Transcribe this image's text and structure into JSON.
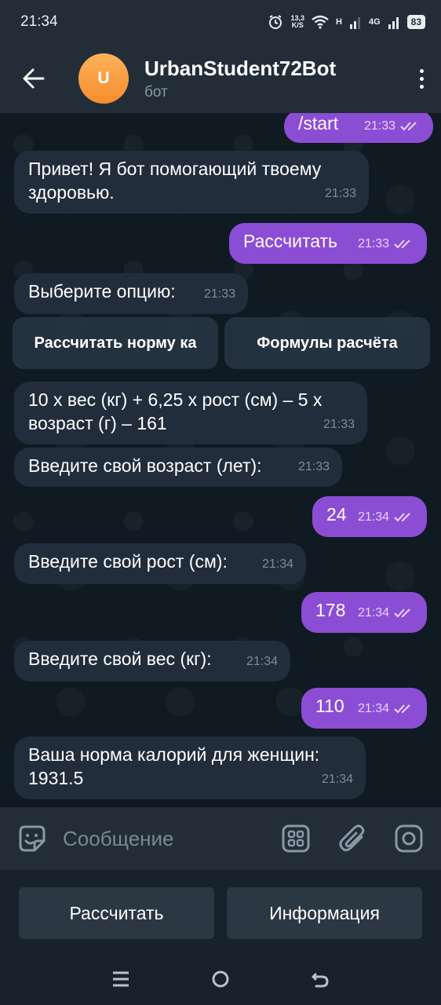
{
  "status_bar": {
    "time": "21:34",
    "net_speed_top": "13,3",
    "net_speed_bottom": "K/S",
    "network_type_1": "H",
    "network_type_2": "4G",
    "battery": "83"
  },
  "header": {
    "avatar_letter": "U",
    "title": "UrbanStudent72Bot",
    "subtitle": "бот"
  },
  "messages": [
    {
      "text": "/start",
      "time": "21:33"
    },
    {
      "text": "Привет! Я бот помогающий твоему здоровью.",
      "time": "21:33"
    },
    {
      "text": "Рассчитать",
      "time": "21:33"
    },
    {
      "text": "Выберите опцию:",
      "time": "21:33"
    },
    {
      "text": "10 x вес (кг) + 6,25 x рост (см) – 5 x возраст (г) – 161",
      "time": "21:33"
    },
    {
      "text": "Введите свой возраст (лет):",
      "time": "21:33"
    },
    {
      "text": "24",
      "time": "21:34"
    },
    {
      "text": "Введите свой рост (см):",
      "time": "21:34"
    },
    {
      "text": "178",
      "time": "21:34"
    },
    {
      "text": "Введите свой вес (кг):",
      "time": "21:34"
    },
    {
      "text": "110",
      "time": "21:34"
    },
    {
      "text": "Ваша норма калорий для женщин: 1931.5",
      "time": "21:34"
    }
  ],
  "inline_keyboard": {
    "button_1": "Рассчитать норму ка",
    "button_2": "Формулы расчёта"
  },
  "input": {
    "placeholder": "Сообщение"
  },
  "reply_keyboard": {
    "button_1": "Рассчитать",
    "button_2": "Информация"
  }
}
